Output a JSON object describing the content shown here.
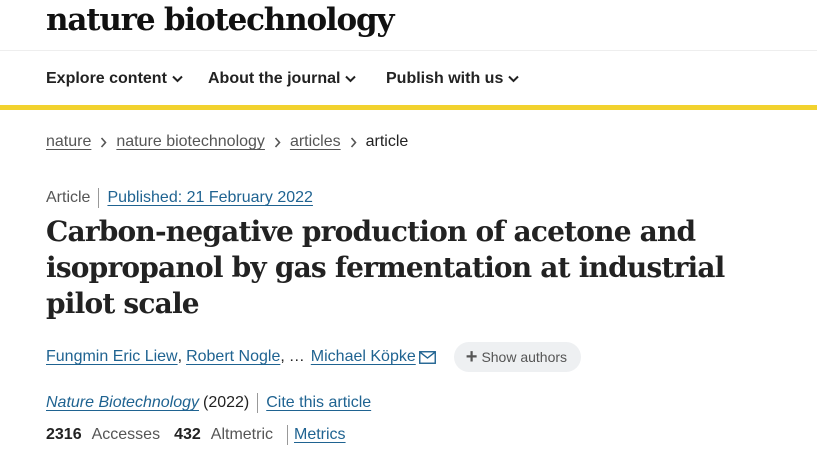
{
  "brand": "nature biotechnology",
  "nav": {
    "items": [
      {
        "label": "Explore content"
      },
      {
        "label": "About the journal"
      },
      {
        "label": "Publish with us"
      }
    ],
    "accent_color": "#f2d22e"
  },
  "breadcrumb": [
    {
      "label": "nature"
    },
    {
      "label": "nature biotechnology"
    },
    {
      "label": "articles"
    },
    {
      "label": "article"
    }
  ],
  "article": {
    "type": "Article",
    "published": "Published: 21 February 2022",
    "title": "Carbon-negative production of acetone and isopropanol by gas fermentation at industrial pilot scale",
    "authors": [
      "Fungmin Eric Liew",
      "Robert Nogle",
      "Michael Köpke"
    ],
    "author_sep_comma": ",",
    "author_ellipsis": "…",
    "show_authors_label": "Show authors",
    "journal": "Nature Biotechnology",
    "year": "(2022)",
    "cite_label": "Cite this article",
    "accesses_count": "2316",
    "accesses_label": "Accesses",
    "altmetric_count": "432",
    "altmetric_label": "Altmetric",
    "metrics_label": "Metrics"
  }
}
